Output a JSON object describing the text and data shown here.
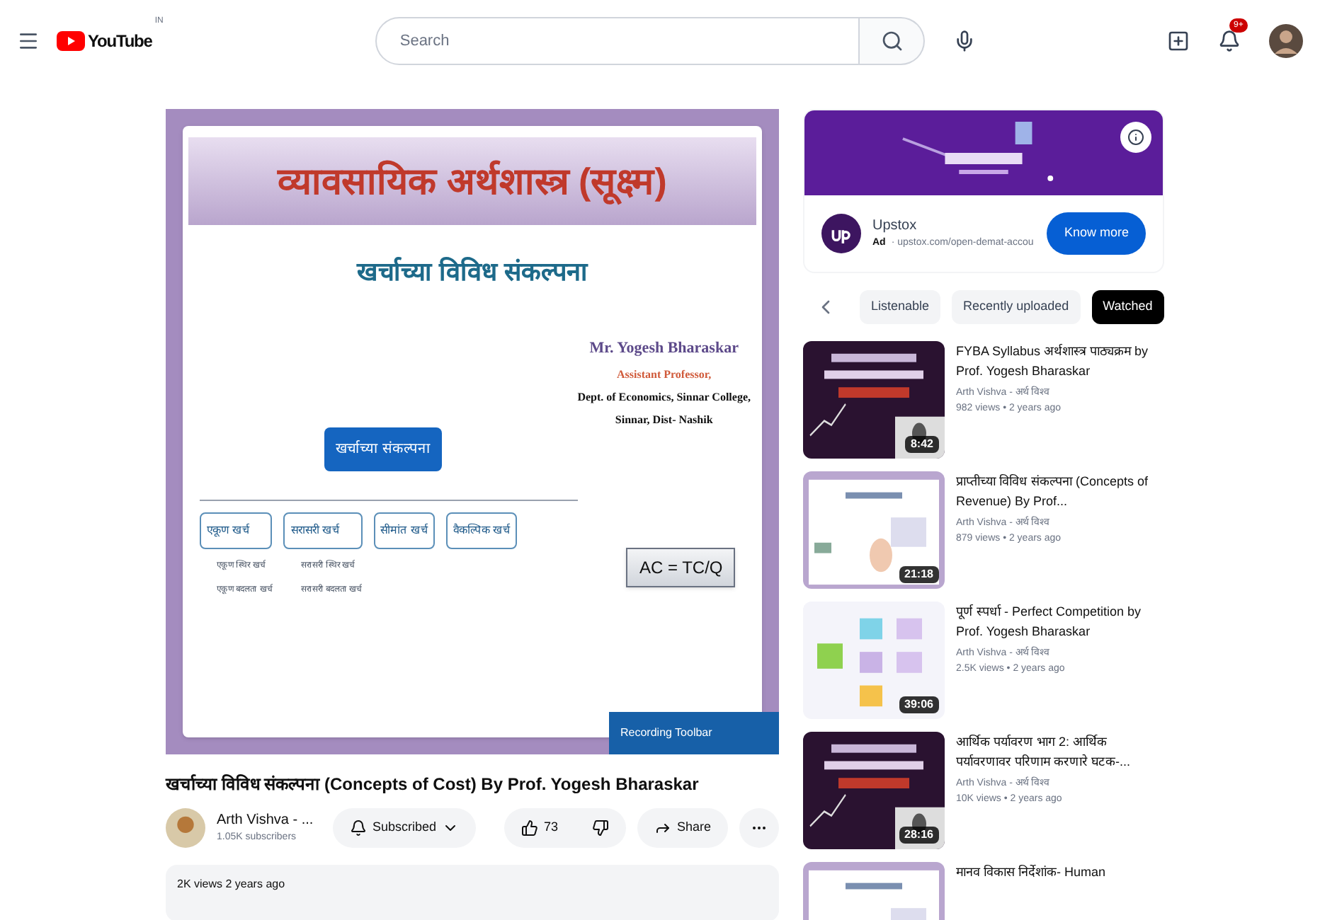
{
  "header": {
    "logo_text": "YouTube",
    "logo_badge": "IN",
    "search": {
      "placeholder": "Search"
    },
    "notification_count": "9+"
  },
  "video": {
    "slide": {
      "heading": "व्यावसायिक अर्थशास्त्र (सूक्ष्म)",
      "subheading": "खर्चाच्या विविध संकल्पना",
      "author": "Mr. Yogesh Bharaskar",
      "role": "Assistant Professor,",
      "dept": "Dept. of Economics,  Sinnar College,",
      "place": "Sinnar, Dist- Nashik",
      "root": "खर्चाच्या संकल्पना",
      "nodes": [
        {
          "label": "एकूण खर्च",
          "children": [
            "एकूण स्थिर खर्च",
            "एकूण बदलता खर्च"
          ]
        },
        {
          "label": "सरासरी खर्च",
          "children": [
            "सरासरी स्थिर खर्च",
            "सरासरी बदलता खर्च"
          ]
        },
        {
          "label": "सीमांत खर्च"
        },
        {
          "label": "वैकल्पिक खर्च"
        }
      ],
      "formula": "AC = TC/Q"
    },
    "overlay": "Recording Toolbar"
  },
  "title": "खर्चाच्या विविध संकल्पना (Concepts of Cost) By Prof. Yogesh Bharaskar",
  "channel": {
    "name": "Arth Vishva - ...",
    "subscribers": "1.05K subscribers",
    "subscribe_label": "Subscribed"
  },
  "actions": {
    "likes": "73",
    "share": "Share"
  },
  "description": {
    "meta": "2K views  2 years ago"
  },
  "ad": {
    "name": "Upstox",
    "ad_label": "Ad",
    "url": "· upstox.com/open-demat-accou",
    "cta": "Know more"
  },
  "chips": [
    {
      "label": "Listenable",
      "selected": false
    },
    {
      "label": "Recently uploaded",
      "selected": false
    },
    {
      "label": "Watched",
      "selected": true
    }
  ],
  "related": [
    {
      "title": "FYBA Syllabus अर्थशास्त्र पाठ्यक्रम by Prof. Yogesh Bharaskar",
      "channel": "Arth Vishva - अर्थ विश्व",
      "meta": "982 views • 2 years ago",
      "duration": "8:42",
      "kind": "dark"
    },
    {
      "title": "प्राप्तीच्या विविध संकल्पना (Concepts of Revenue) By Prof...",
      "channel": "Arth Vishva - अर्थ विश्व",
      "meta": "879 views • 2 years ago",
      "duration": "21:18",
      "kind": "light"
    },
    {
      "title": "पूर्ण स्पर्धा - Perfect Competition by Prof. Yogesh Bharaskar",
      "channel": "Arth Vishva - अर्थ विश्व",
      "meta": "2.5K views • 2 years ago",
      "duration": "39:06",
      "kind": "diagram"
    },
    {
      "title": "आर्थिक पर्यावरण भाग 2: आर्थिक पर्यावरणावर परिणाम करणारे घटक-...",
      "channel": "Arth Vishva - अर्थ विश्व",
      "meta": "10K views • 2 years ago",
      "duration": "28:16",
      "kind": "dark"
    },
    {
      "title": "मानव विकास निर्देशांक- Human",
      "kind": "light"
    }
  ]
}
